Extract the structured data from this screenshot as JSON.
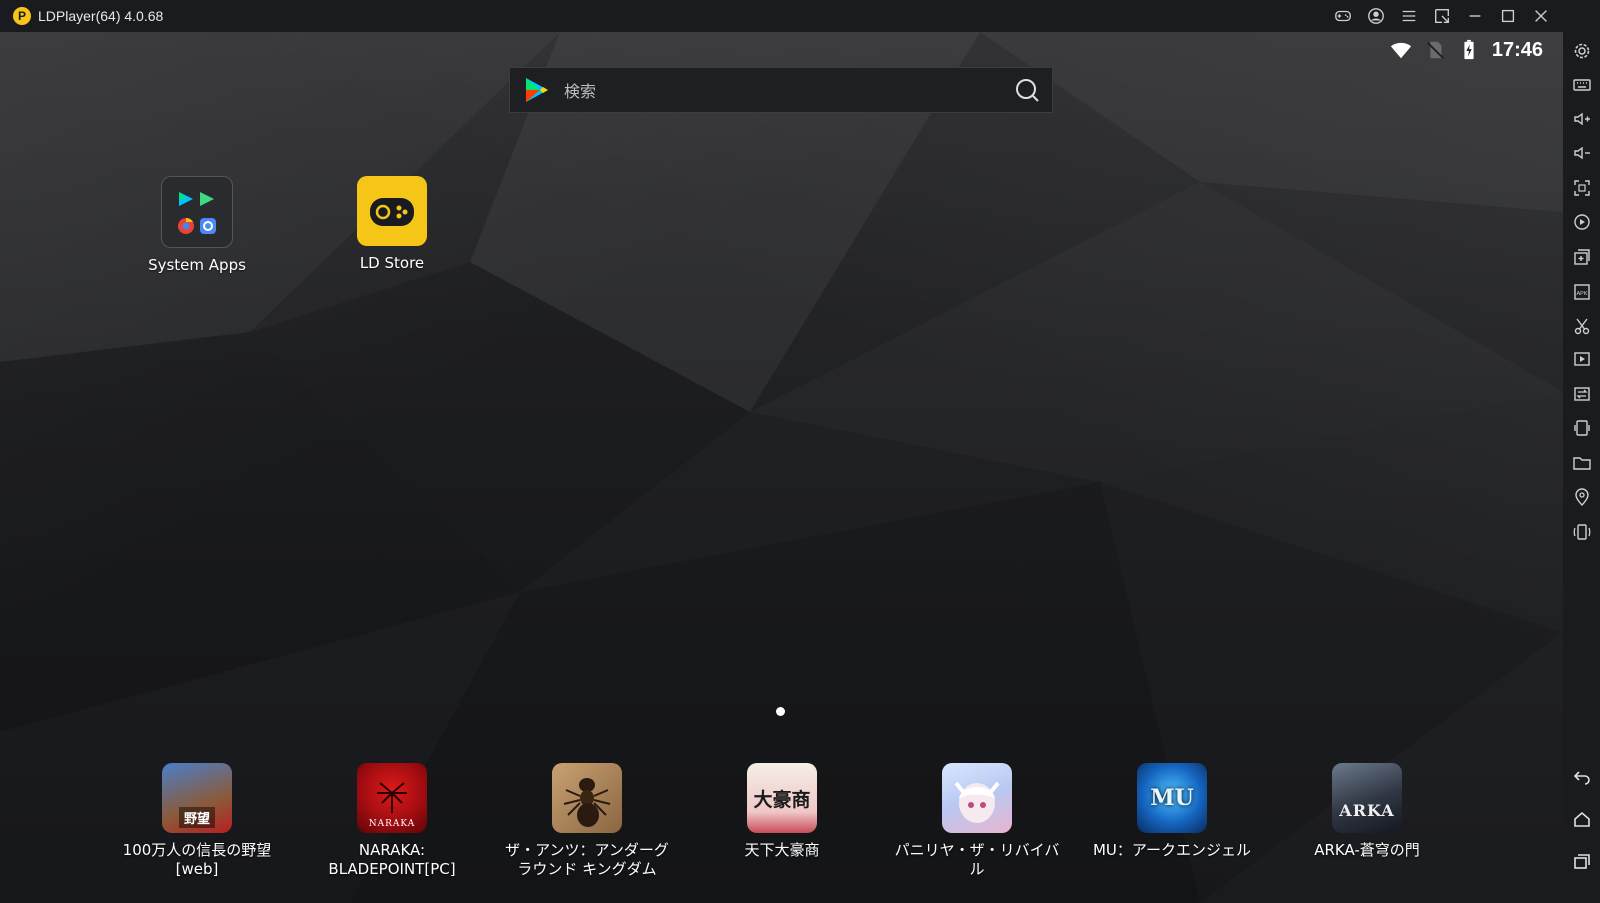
{
  "window": {
    "title": "LDPlayer(64) 4.0.68",
    "logo_letter": "P"
  },
  "status_bar": {
    "time": "17:46"
  },
  "search": {
    "placeholder": "検索"
  },
  "desktop_apps": [
    {
      "label": "System Apps",
      "icon": "system-apps-folder-icon"
    },
    {
      "label": "LD Store",
      "icon": "ld-store-icon"
    }
  ],
  "dock_apps": [
    {
      "label_line1": "100万人の信長の野望",
      "label_line2": "[web]",
      "icon": "nobunaga-icon",
      "icon_text": "野望"
    },
    {
      "label_line1": "NARAKA:",
      "label_line2": "BLADEPOINT[PC]",
      "icon": "naraka-icon",
      "icon_text": "NARAKA"
    },
    {
      "label_line1": "ザ・アンツ：アンダーグ",
      "label_line2": "ラウンド キングダム",
      "icon": "ants-icon",
      "icon_text": ""
    },
    {
      "label_line1": "天下大豪商",
      "label_line2": "",
      "icon": "tenka-daigosho-icon",
      "icon_text": "大豪商"
    },
    {
      "label_line1": "パニリヤ・ザ・リバイバ",
      "label_line2": "ル",
      "icon": "vanilla-icon",
      "icon_text": ""
    },
    {
      "label_line1": "MU：アークエンジェル",
      "label_line2": "",
      "icon": "mu-archangel-icon",
      "icon_text": "MU"
    },
    {
      "label_line1": "ARKA-蒼穹の門",
      "label_line2": "",
      "icon": "arka-icon",
      "icon_text": "ARKA"
    }
  ],
  "colors": {
    "accent_yellow": "#f5c518",
    "titlebar_bg": "#1a1b1e",
    "sidebar_bg": "#1a1b1e"
  }
}
